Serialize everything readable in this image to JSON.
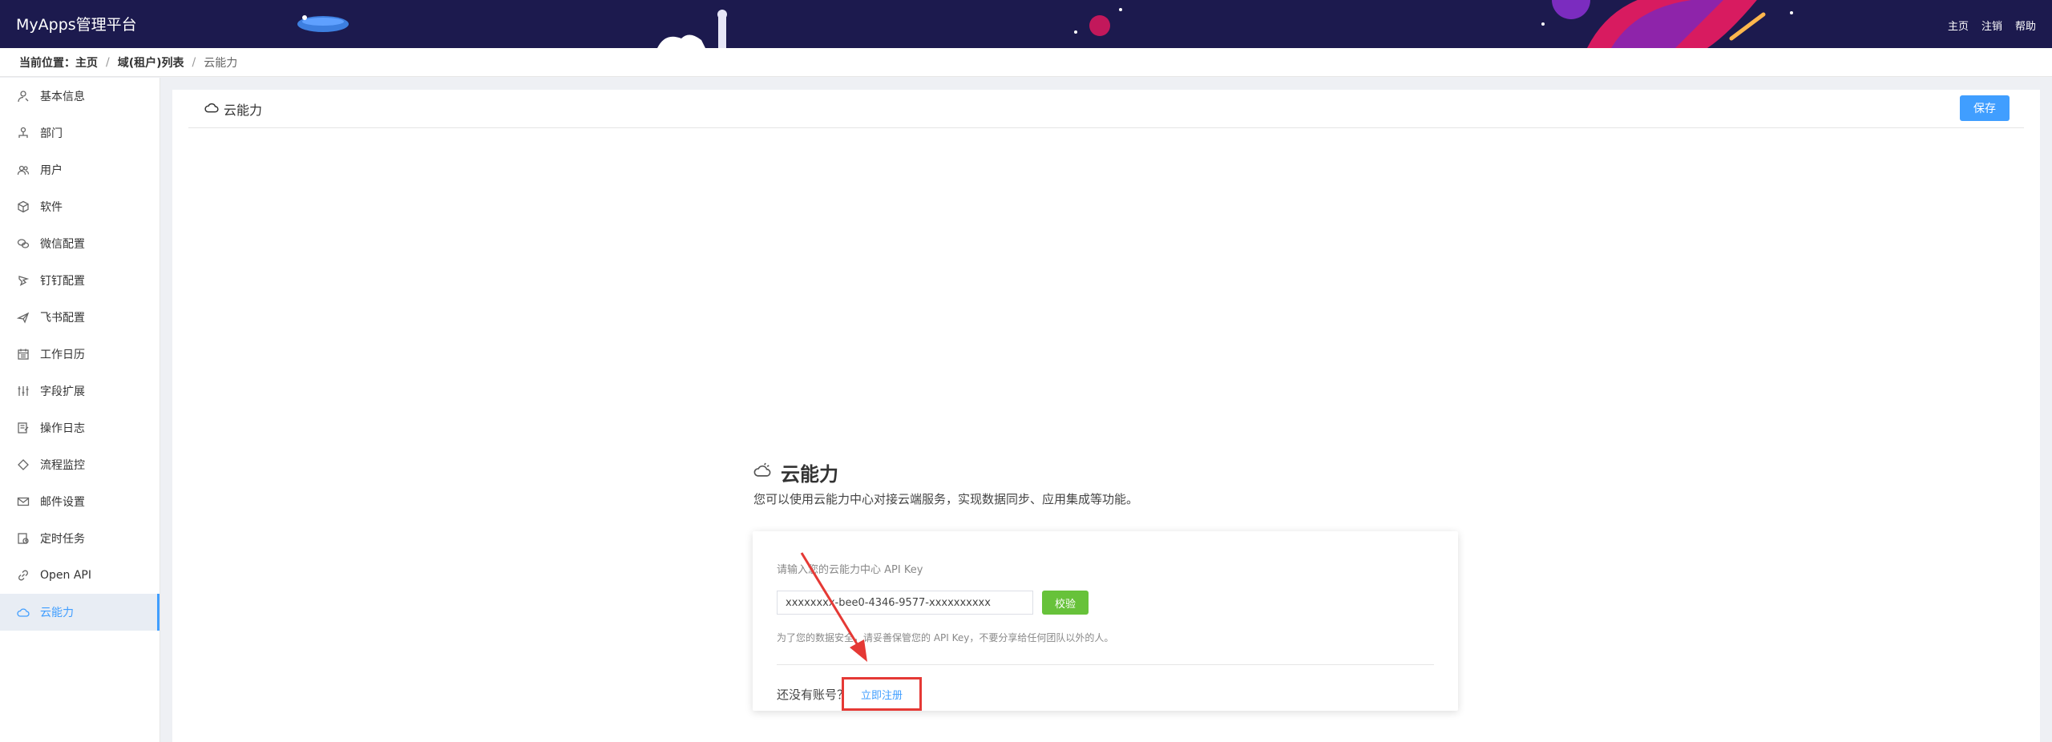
{
  "header": {
    "brand": "MyApps管理平台",
    "nav": [
      "主页",
      "注销",
      "帮助"
    ],
    "bg_color": "#1c1a4e"
  },
  "breadcrumb": {
    "prefix": "当前位置：",
    "home": "主页",
    "separator": "/",
    "list": "域(租户)列表",
    "current": "云能力"
  },
  "sidebar": {
    "items": [
      {
        "label": "基本信息",
        "icon": "user-icon"
      },
      {
        "label": "部门",
        "icon": "org-icon"
      },
      {
        "label": "用户",
        "icon": "users-icon"
      },
      {
        "label": "软件",
        "icon": "cube-icon"
      },
      {
        "label": "微信配置",
        "icon": "wechat-icon"
      },
      {
        "label": "钉钉配置",
        "icon": "dingtalk-icon"
      },
      {
        "label": "飞书配置",
        "icon": "feishu-icon"
      },
      {
        "label": "工作日历",
        "icon": "calendar-icon"
      },
      {
        "label": "字段扩展",
        "icon": "sliders-icon"
      },
      {
        "label": "操作日志",
        "icon": "log-icon"
      },
      {
        "label": "流程监控",
        "icon": "diamond-icon"
      },
      {
        "label": "邮件设置",
        "icon": "mail-icon"
      },
      {
        "label": "定时任务",
        "icon": "task-icon"
      },
      {
        "label": "Open API",
        "icon": "link-icon"
      },
      {
        "label": "云能力",
        "icon": "cloud-icon",
        "active": true
      }
    ],
    "active_color": "#409eff"
  },
  "panel": {
    "title": "云能力",
    "save_label": "保存"
  },
  "cloud": {
    "title": "云能力",
    "description": "您可以使用云能力中心对接云端服务，实现数据同步、应用集成等功能。",
    "api_label": "请输入您的云能力中心 API Key",
    "api_value": "xxxxxxxx-bee0-4346-9577-xxxxxxxxxx",
    "verify_label": "校验",
    "hint": "为了您的数据安全，请妥善保管您的 API Key，不要分享给任何团队以外的人。",
    "no_account": "还没有账号？",
    "register_label": "立即注册"
  },
  "colors": {
    "primary": "#409eff",
    "success": "#67c23a",
    "highlight": "#e53935"
  }
}
